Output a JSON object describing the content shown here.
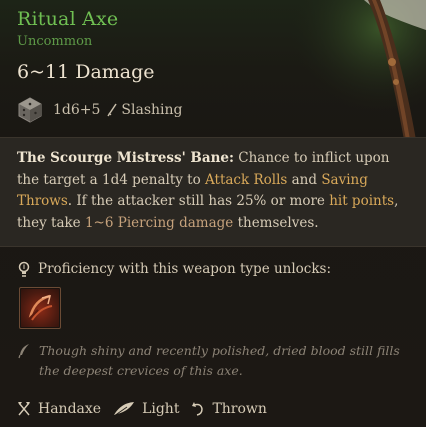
{
  "item": {
    "name": "Ritual Axe",
    "rarity": "Uncommon",
    "damage": "6~11 Damage",
    "dice": "1d6+5",
    "damage_type": "Slashing"
  },
  "passive": {
    "name": "The Scourge Mistress' Bane:",
    "text_1": "Chance to inflict upon the target a 1d4 penalty to",
    "kw_attack_rolls": "Attack Rolls",
    "and": "and",
    "kw_saving_throws": "Saving Throws",
    "text_2": ". If the attacker still has 25% or more",
    "kw_hit_points": "hit points",
    "text_3": ", they take",
    "kw_piercing": "1~6 Piercing damage",
    "text_4": "themselves."
  },
  "proficiency": {
    "label": "Proficiency with this weapon type unlocks:"
  },
  "flavor": "Though shiny and recently polished, dried blood still fills the deepest crevices of this axe.",
  "properties": [
    "Handaxe",
    "Light",
    "Thrown"
  ],
  "colors": {
    "rarity_green": "#6fbf52",
    "keyword": "#d9a95a",
    "passive_bg": "#2a2722"
  },
  "icons": {
    "dice": "d6-dice-icon",
    "damage_type": "slashing-icon",
    "proficiency": "lightbulb-icon",
    "ability": "cleave-ability-icon",
    "flavor": "quill-icon",
    "props": [
      "crossed-axes-icon",
      "feather-icon",
      "throw-arrow-icon"
    ]
  }
}
